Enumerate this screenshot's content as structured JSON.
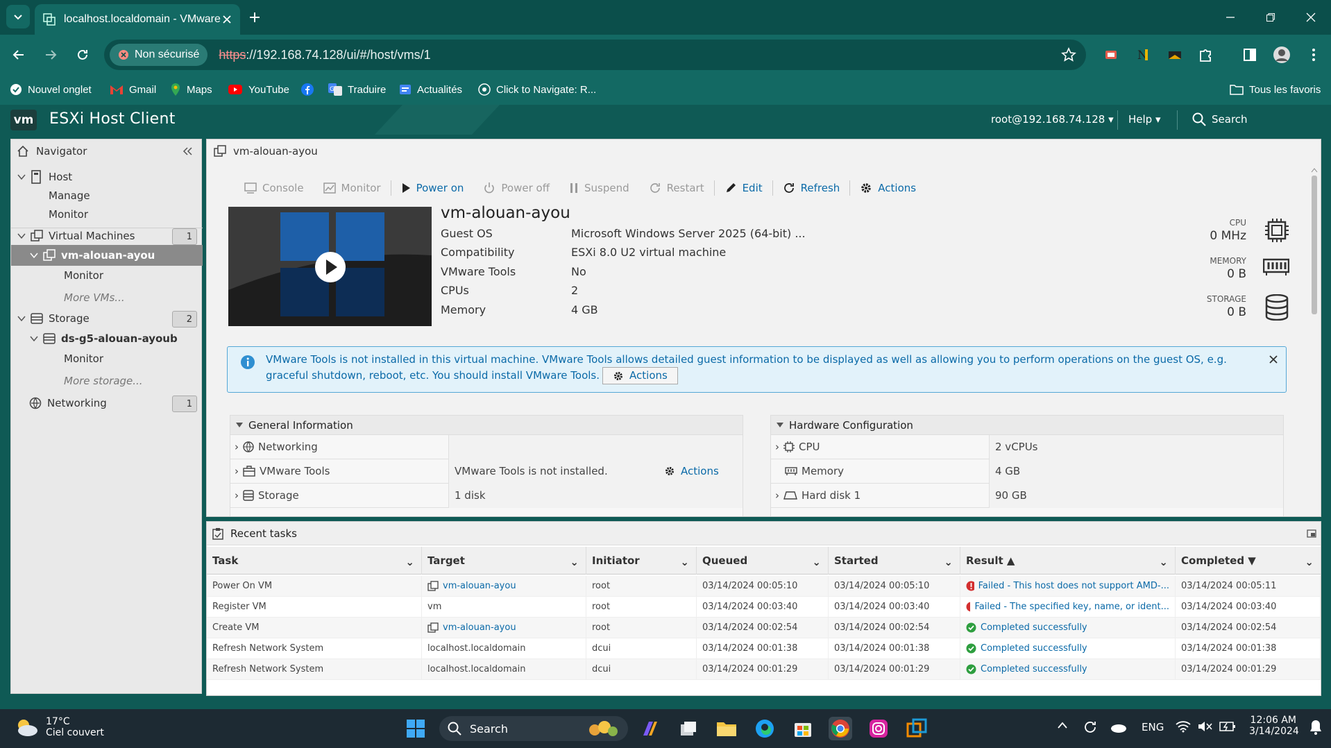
{
  "browser": {
    "tab_title": "localhost.localdomain - VMware",
    "security_label": "Non sécurisé",
    "url_scheme": "https",
    "url_rest": "://192.168.74.128/ui/#/host/vms/1",
    "bookmarks": [
      {
        "label": "Nouvel onglet",
        "icon": "new-tab-icon"
      },
      {
        "label": "Gmail",
        "icon": "gmail-icon"
      },
      {
        "label": "Maps",
        "icon": "maps-icon"
      },
      {
        "label": "YouTube",
        "icon": "youtube-icon"
      },
      {
        "label": "",
        "icon": "facebook-icon"
      },
      {
        "label": "Traduire",
        "icon": "translate-icon"
      },
      {
        "label": "Actualités",
        "icon": "news-icon"
      },
      {
        "label": "Click to Navigate: R...",
        "icon": "navigate-icon"
      }
    ],
    "all_bookmarks": "Tous les favoris"
  },
  "app": {
    "logo": "vm",
    "title": "ESXi Host Client",
    "user": "root@192.168.74.128",
    "help": "Help",
    "search": "Search"
  },
  "navigator": {
    "title": "Navigator",
    "host": "Host",
    "manage": "Manage",
    "monitor": "Monitor",
    "virtual_machines": "Virtual Machines",
    "vm_count": "1",
    "vm_name": "vm-alouan-ayou",
    "vm_monitor": "Monitor",
    "more_vms": "More VMs...",
    "storage": "Storage",
    "storage_count": "2",
    "datastore": "ds-g5-alouan-ayoub",
    "ds_monitor": "Monitor",
    "more_storage": "More storage...",
    "networking": "Networking",
    "net_count": "1"
  },
  "vm": {
    "breadcrumb": "vm-alouan-ayou",
    "toolbar": {
      "console": "Console",
      "monitor": "Monitor",
      "power_on": "Power on",
      "power_off": "Power off",
      "suspend": "Suspend",
      "restart": "Restart",
      "edit": "Edit",
      "refresh": "Refresh",
      "actions": "Actions"
    },
    "name": "vm-alouan-ayou",
    "details": [
      {
        "key": "Guest OS",
        "value": "Microsoft Windows Server 2025 (64-bit) ..."
      },
      {
        "key": "Compatibility",
        "value": "ESXi 8.0 U2 virtual machine"
      },
      {
        "key": "VMware Tools",
        "value": "No"
      },
      {
        "key": "CPUs",
        "value": "2"
      },
      {
        "key": "Memory",
        "value": "4 GB"
      }
    ],
    "resources": {
      "cpu_label": "CPU",
      "cpu_value": "0 MHz",
      "mem_label": "MEMORY",
      "mem_value": "0 B",
      "storage_label": "STORAGE",
      "storage_value": "0 B"
    },
    "banner": {
      "text": "VMware Tools is not installed in this virtual machine. VMware Tools allows detailed guest information to be displayed as well as allowing you to perform operations on the guest OS, e.g. graceful shutdown, reboot, etc. You should install VMware Tools.",
      "actions": "Actions"
    },
    "general": {
      "title": "General Information",
      "rows": [
        {
          "key": "Networking",
          "value": ""
        },
        {
          "key": "VMware Tools",
          "value": "VMware Tools is not installed.",
          "action": "Actions"
        },
        {
          "key": "Storage",
          "value": "1 disk"
        }
      ]
    },
    "hardware": {
      "title": "Hardware Configuration",
      "rows": [
        {
          "key": "CPU",
          "value": "2 vCPUs"
        },
        {
          "key": "Memory",
          "value": "4 GB"
        },
        {
          "key": "Hard disk 1",
          "value": "90 GB"
        }
      ]
    }
  },
  "tasks": {
    "title": "Recent tasks",
    "columns": [
      "Task",
      "Target",
      "Initiator",
      "Queued",
      "Started",
      "Result ▲",
      "Completed ▼"
    ],
    "rows": [
      {
        "task": "Power On VM",
        "target": "vm-alouan-ayou",
        "target_link": true,
        "initiator": "root",
        "queued": "03/14/2024 00:05:10",
        "started": "03/14/2024 00:05:10",
        "result": "Failed - This host does not support AMD-...",
        "status": "error",
        "completed": "03/14/2024 00:05:11"
      },
      {
        "task": "Register VM",
        "target": "vm",
        "target_link": false,
        "initiator": "root",
        "queued": "03/14/2024 00:03:40",
        "started": "03/14/2024 00:03:40",
        "result": "Failed - The specified key, name, or ident...",
        "status": "error",
        "completed": "03/14/2024 00:03:40"
      },
      {
        "task": "Create VM",
        "target": "vm-alouan-ayou",
        "target_link": true,
        "initiator": "root",
        "queued": "03/14/2024 00:02:54",
        "started": "03/14/2024 00:02:54",
        "result": "Completed successfully",
        "status": "ok",
        "completed": "03/14/2024 00:02:54"
      },
      {
        "task": "Refresh Network System",
        "target": "localhost.localdomain",
        "target_link": false,
        "initiator": "dcui",
        "queued": "03/14/2024 00:01:38",
        "started": "03/14/2024 00:01:38",
        "result": "Completed successfully",
        "status": "ok",
        "completed": "03/14/2024 00:01:38"
      },
      {
        "task": "Refresh Network System",
        "target": "localhost.localdomain",
        "target_link": false,
        "initiator": "dcui",
        "queued": "03/14/2024 00:01:29",
        "started": "03/14/2024 00:01:29",
        "result": "Completed successfully",
        "status": "ok",
        "completed": "03/14/2024 00:01:29"
      }
    ]
  },
  "taskbar": {
    "temp": "17°C",
    "weather": "Ciel couvert",
    "search": "Search",
    "lang": "ENG",
    "time": "12:06 AM",
    "date": "3/14/2024"
  },
  "colors": {
    "chrome": "#136963",
    "esxi_header": "#0f5a55",
    "link": "#0b6aa8",
    "error": "#d32f2f",
    "success": "#2e9e3f"
  }
}
